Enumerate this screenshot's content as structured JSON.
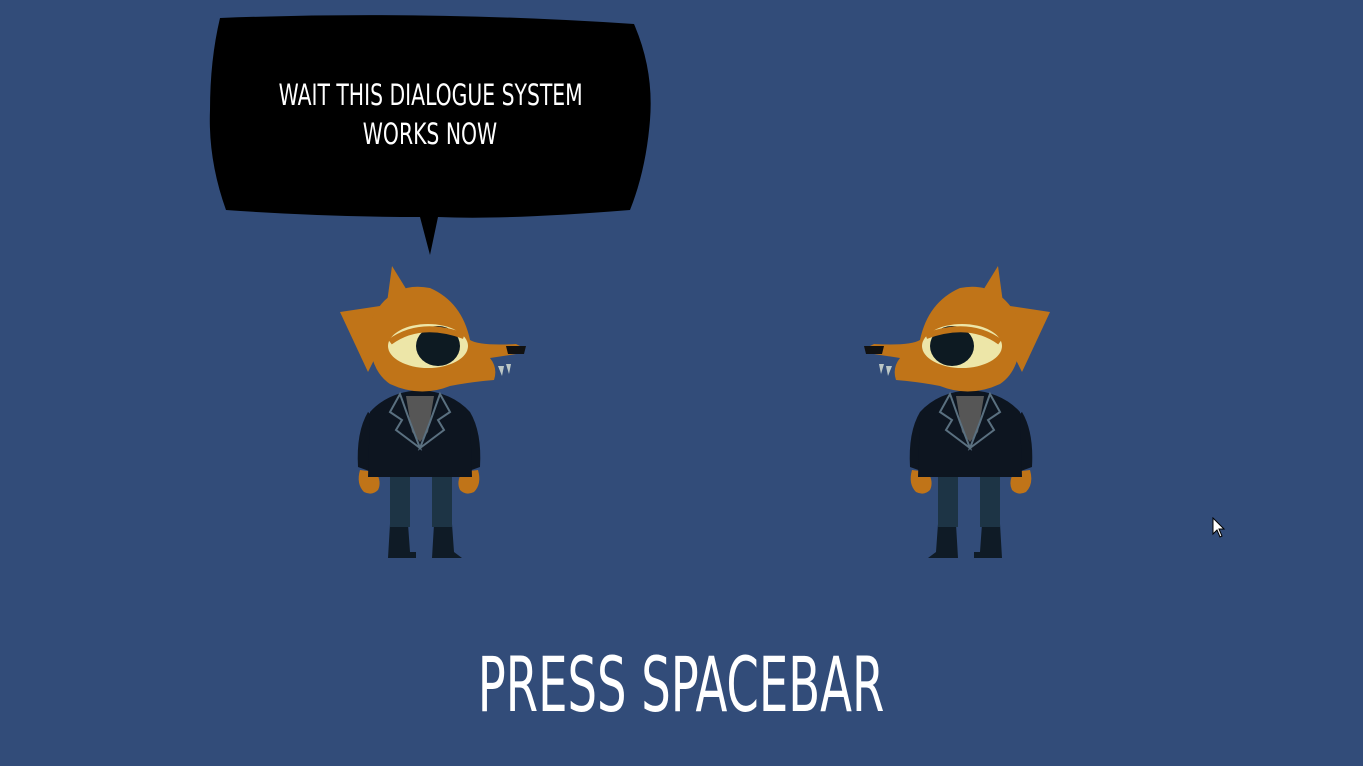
{
  "scene": {
    "background_color": "#324c79",
    "speech_bubble": {
      "lines": [
        "WAIT THIS DIALOGUE SYSTEM",
        "WORKS NOW"
      ],
      "fill_color": "#000000",
      "text_color": "#ffffff"
    },
    "characters": [
      {
        "name": "fox-character",
        "facing": "right"
      },
      {
        "name": "fox-character",
        "facing": "left"
      }
    ],
    "prompt": "PRESS SPACEBAR",
    "cursor": "arrow-pointer-icon"
  }
}
